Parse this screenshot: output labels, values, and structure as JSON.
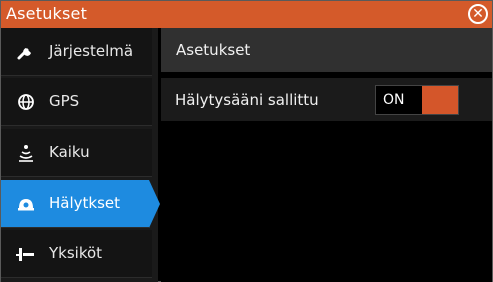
{
  "window": {
    "title": "Asetukset",
    "accent_color": "#d45a2a"
  },
  "sidebar": {
    "selected_color": "#1e8be0",
    "items": [
      {
        "label": "Järjestelmä",
        "icon": "wrench-icon",
        "selected": false
      },
      {
        "label": "GPS",
        "icon": "globe-icon",
        "selected": false
      },
      {
        "label": "Kaiku",
        "icon": "sonar-icon",
        "selected": false
      },
      {
        "label": "Hälytkset",
        "icon": "alarm-icon",
        "selected": true
      },
      {
        "label": "Yksiköt",
        "icon": "units-icon",
        "selected": false
      }
    ]
  },
  "main": {
    "header": "Asetukset",
    "settings": [
      {
        "label": "Hälytysääni sallittu",
        "value": "ON"
      }
    ]
  }
}
